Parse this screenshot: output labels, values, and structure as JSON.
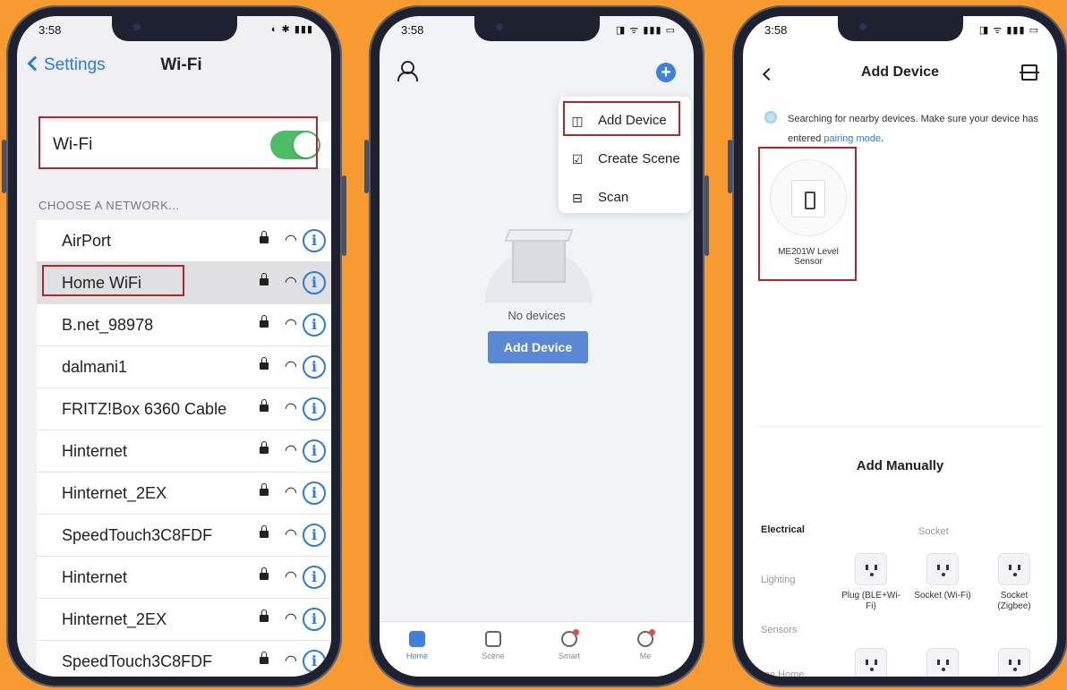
{
  "phone1": {
    "status_time": "3:58",
    "status_icons": "◐ ✱ ▮▮▮",
    "nav_back": "Settings",
    "nav_title": "Wi-Fi",
    "wifi_label": "Wi-Fi",
    "wifi_on": true,
    "section_header": "CHOOSE A NETWORK...",
    "networks": [
      {
        "name": "AirPort"
      },
      {
        "name": "Home WiFi",
        "selected": true
      },
      {
        "name": "B.net_98978"
      },
      {
        "name": "dalmani1"
      },
      {
        "name": "FRITZ!Box 6360 Cable"
      },
      {
        "name": "Hinternet"
      },
      {
        "name": "Hinternet_2EX"
      },
      {
        "name": "SpeedTouch3C8FDF"
      },
      {
        "name": "Hinternet"
      },
      {
        "name": "Hinternet_2EX"
      },
      {
        "name": "SpeedTouch3C8FDF"
      }
    ],
    "info_glyph": "i",
    "wifi_glyph": "◠"
  },
  "phone2": {
    "status_time": "3:58",
    "status_icons": "◨ ᯤ ▮▮▮ ▭",
    "menu": [
      {
        "icon": "add-device-icon",
        "glyph": "◫",
        "label": "Add Device"
      },
      {
        "icon": "create-scene-icon",
        "glyph": "☑",
        "label": "Create Scene"
      },
      {
        "icon": "scan-icon",
        "glyph": "⊟",
        "label": "Scan"
      }
    ],
    "empty_text": "No devices",
    "add_button": "Add Device",
    "plus_glyph": "+",
    "tabs": [
      {
        "label": "Home",
        "active": true
      },
      {
        "label": "Scene"
      },
      {
        "label": "Smart",
        "badge": true
      },
      {
        "label": "Me",
        "badge": true
      }
    ]
  },
  "phone3": {
    "status_time": "3:58",
    "status_icons": "◨ ᯤ ▮▮▮ ▭",
    "title": "Add Device",
    "searching_text": "Searching for nearby devices. Make sure your device has entered ",
    "pairing_link": "pairing mode",
    "searching_end": ".",
    "found_device": "ME201W Level Sensor",
    "add_manually": "Add Manually",
    "categories": [
      "Electrical",
      "Lighting",
      "Sensors",
      "arge Home"
    ],
    "socket_header": "Socket",
    "sockets": [
      {
        "label": "Plug (BLE+Wi-Fi)"
      },
      {
        "label": "Socket (Wi-Fi)"
      },
      {
        "label": "Socket (Zigbee)"
      }
    ]
  },
  "colors": {
    "background": "#f79a2f",
    "ios_blue": "#2b7be0",
    "toggle_green": "#4cbd64",
    "highlight_red": "#b3262d",
    "button_blue": "#5b88d4"
  }
}
